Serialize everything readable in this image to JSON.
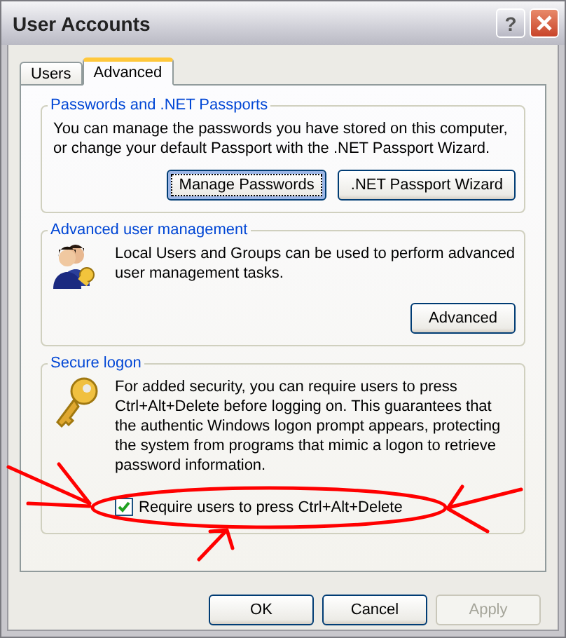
{
  "window": {
    "title": "User Accounts",
    "help": "?"
  },
  "tabs": [
    {
      "label": "Users",
      "selected": false
    },
    {
      "label": "Advanced",
      "selected": true
    }
  ],
  "groups": [
    {
      "title": "Passwords and .NET Passports",
      "kind": "plain",
      "text": "You can manage the passwords you have stored on this computer, or change your default Passport with the .NET Passport Wizard.",
      "buttons": [
        {
          "label": "Manage Passwords",
          "focused": true
        },
        {
          "label": ".NET Passport Wizard",
          "focused": false
        }
      ]
    },
    {
      "title": "Advanced user management",
      "kind": "users",
      "text": "Local Users and Groups can be used to perform advanced user management tasks.",
      "buttons": [
        {
          "label": "Advanced",
          "focused": false
        }
      ]
    },
    {
      "title": "Secure logon",
      "kind": "key",
      "text": "For added security, you can require users to press Ctrl+Alt+Delete before logging on. This guarantees that the authentic Windows logon prompt appears, protecting the system from programs that mimic a logon to retrieve password information.",
      "checkbox": {
        "label": "Require users to press Ctrl+Alt+Delete",
        "checked": true
      }
    }
  ],
  "footer_buttons": [
    {
      "label": "OK",
      "disabled": false
    },
    {
      "label": "Cancel",
      "disabled": false
    },
    {
      "label": "Apply",
      "disabled": true
    }
  ]
}
